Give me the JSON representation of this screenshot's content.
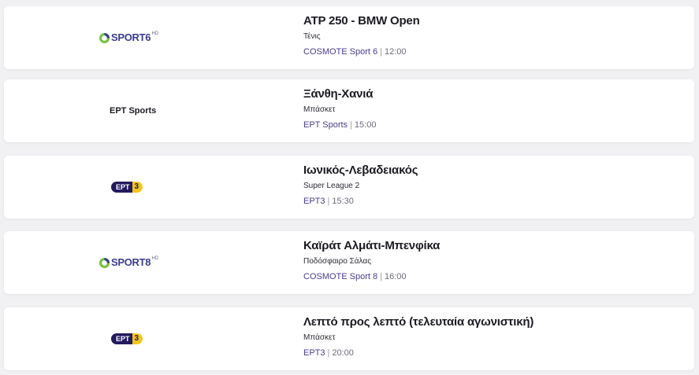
{
  "events": [
    {
      "logo": {
        "type": "cosmote-sport",
        "word": "SPORT",
        "number": "6",
        "hd": "HD",
        "icon": "cosmote-swirl-icon"
      },
      "title": "ATP 250 - BMW Open",
      "sport": "Τένις",
      "channel": "COSMOTE Sport 6",
      "separator": "|",
      "time": "12:00"
    },
    {
      "logo": {
        "type": "ert-sports-text",
        "text": "ΕΡΤ Sports"
      },
      "title": "Ξάνθη-Χανιά",
      "sport": "Μπάσκετ",
      "channel": "ΕΡΤ Sports",
      "separator": "|",
      "time": "15:00"
    },
    {
      "logo": {
        "type": "ert3",
        "left": "ΕΡΤ",
        "right": "3"
      },
      "title": "Ιωνικός-Λεβαδειακός",
      "sport": "Super League 2",
      "channel": "ΕΡΤ3",
      "separator": "|",
      "time": "15:30"
    },
    {
      "logo": {
        "type": "cosmote-sport",
        "word": "SPORT",
        "number": "8",
        "hd": "HD",
        "icon": "cosmote-swirl-icon"
      },
      "title": "Καϊράτ Αλμάτι-Μπενφίκα",
      "sport": "Ποδόσφαιρο Σάλας",
      "channel": "COSMOTE Sport 8",
      "separator": "|",
      "time": "16:00"
    },
    {
      "logo": {
        "type": "ert3",
        "left": "ΕΡΤ",
        "right": "3"
      },
      "title": "Λεπτό προς λεπτό (τελευταία αγωνιστική)",
      "sport": "Μπάσκετ",
      "channel": "ΕΡΤ3",
      "separator": "|",
      "time": "20:00"
    }
  ],
  "colors": {
    "background": "#f1f1f3",
    "card": "#ffffff",
    "title": "#1b1b22",
    "channel": "#4a3a8c",
    "time": "#6d6b78",
    "cosmote_green": "#7ac143",
    "cosmote_blue": "#3a3d8f",
    "ert_navy": "#231a5e",
    "ert_yellow": "#f3c51b"
  }
}
